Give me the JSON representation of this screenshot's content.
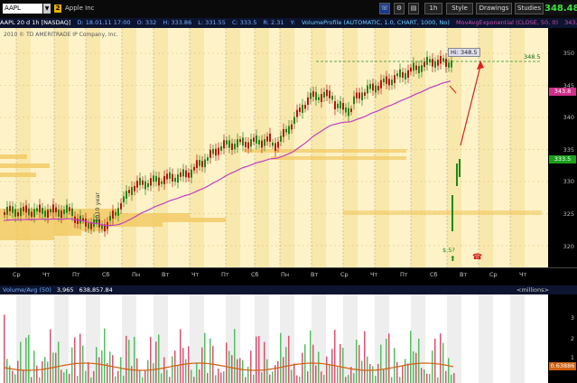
{
  "header": {
    "symbol": "AAPL",
    "link_group": "2",
    "company": "Apple Inc",
    "buttons": [
      "1h",
      "Style",
      "Drawings",
      "Studies"
    ],
    "last_price": "348.48"
  },
  "infobar": {
    "period": "AAPL 20 d 1h [NASDAQ]",
    "date": "D: 18.01.11 17:00",
    "open": "O: 332",
    "high": "H: 333.86",
    "low": "L: 331.55",
    "close": "C: 333.5",
    "range": "R: 2.31",
    "y": "Y:",
    "vp_study": "VolumeProfile (AUTOMATIC, 1.0, CHART, 1000, No)",
    "ma_study": "MovAvgExponential (CLOSE, 50, 0)",
    "ma_value": "343.8"
  },
  "chart": {
    "copyright": "2010 © TD AMERITRADE IP Company, Inc.",
    "hi_label": "Hi: 348.5",
    "hi_price_label": "348.5",
    "year_label": "2010 year",
    "dividend_label": "$.5?",
    "price_ticks": [
      "350",
      "345",
      "340",
      "335",
      "330",
      "325",
      "320"
    ],
    "badges": [
      {
        "label": "343.8",
        "color": "#d0308a"
      },
      {
        "label": "333.5",
        "color": "#1aa01a"
      }
    ],
    "x_labels": [
      "Ср",
      "Чт",
      "Пт",
      "Сб",
      "Пн",
      "Вт",
      "Чт",
      "Пт",
      "Сб",
      "Пн",
      "Вт",
      "Ср",
      "Чт",
      "Пт",
      "Сб",
      "Вт",
      "Ср",
      "Чт"
    ]
  },
  "volume": {
    "label": "Volume/Avg (50)",
    "value1": "3,965",
    "value2": "638,857.84",
    "units": "<millions>",
    "ticks": [
      "3",
      "2",
      "1"
    ],
    "badge": "0.63886"
  }
}
